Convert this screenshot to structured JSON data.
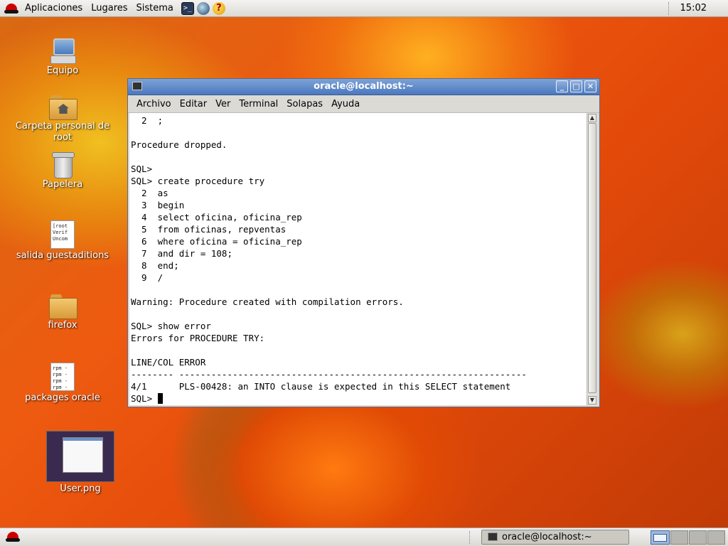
{
  "top_panel": {
    "menus": [
      "Aplicaciones",
      "Lugares",
      "Sistema"
    ],
    "clock": "15:02"
  },
  "desktop_icons": [
    {
      "label": "Equipo"
    },
    {
      "label": "Carpeta personal de root"
    },
    {
      "label": "Papelera"
    },
    {
      "label": "salida guestaditions",
      "preview": "[root\nVerif\nUncom"
    },
    {
      "label": "firefox"
    },
    {
      "label": "packages oracle",
      "preview": "rpm -\nrpm -\nrpm -\nrpm -"
    },
    {
      "label": "User.png"
    }
  ],
  "terminal": {
    "title": "oracle@localhost:~",
    "menu": [
      "Archivo",
      "Editar",
      "Ver",
      "Terminal",
      "Solapas",
      "Ayuda"
    ],
    "lines": [
      "  2  ;",
      "",
      "Procedure dropped.",
      "",
      "SQL>",
      "SQL> create procedure try",
      "  2  as",
      "  3  begin",
      "  4  select oficina, oficina_rep",
      "  5  from oficinas, repventas",
      "  6  where oficina = oficina_rep",
      "  7  and dir = 108;",
      "  8  end;",
      "  9  /",
      "",
      "Warning: Procedure created with compilation errors.",
      "",
      "SQL> show error",
      "Errors for PROCEDURE TRY:",
      "",
      "LINE/COL ERROR",
      "-------- -----------------------------------------------------------------",
      "4/1      PLS-00428: an INTO clause is expected in this SELECT statement"
    ],
    "prompt": "SQL> "
  },
  "taskbar": {
    "window_label": "oracle@localhost:~"
  },
  "colors": {
    "title_bar": "#4a78c0",
    "panel": "#dcdad5"
  }
}
